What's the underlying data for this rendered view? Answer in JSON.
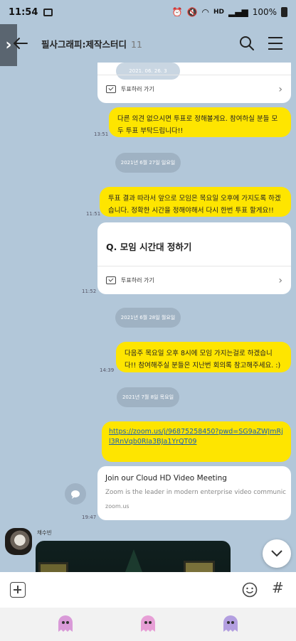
{
  "status_bar": {
    "time": "11:54",
    "network": "HD",
    "battery": "100%"
  },
  "header": {
    "title": "필사그래피:제작스터디",
    "member_count": "11"
  },
  "messages": {
    "card1": {
      "date_overlay": "2021. 06. 26. 3",
      "footer": "투표하러 가기"
    },
    "msg1": {
      "text": "다른 의견 없으시면 투표로 정해볼게요. 참여하실 분들 모두 투표 부탁드립니다!!",
      "time": "13:51"
    },
    "date1": "2021년 6월 27일 일요일",
    "msg2": {
      "text": "투표 결과 따라서 앞으로 모임은 목요일 오후에 가지도록 하겠습니다. 정확한 시간을 정해야해서 다시 한번 투표 할게요!!",
      "time": "11:51"
    },
    "card2": {
      "title": "Q. 모임 시간대 정하기",
      "footer": "투표하러 가기",
      "time": "11:52"
    },
    "date2": "2021년 6월 28일 월요일",
    "msg3": {
      "text": "다음주 목요일 오후 8시에 모임 가지는걸로 하겠습니다!! 참여해주실 분들은 지난번 회의록 참고해주세요. :)",
      "time": "14:39"
    },
    "date3": "2021년 7월 8일 목요일",
    "msg4": {
      "link": "https://zoom.us/j/96875258450?pwd=SG9aZWJmRjl3RnVqb0RIa3BJa1YrQT09"
    },
    "preview": {
      "title": "Join our Cloud HD Video Meeting",
      "desc": "Zoom is the leader in modern enterprise video communic...",
      "domain": "zoom.us",
      "time": "19:47"
    },
    "sender": {
      "name": "채수빈"
    }
  },
  "colors": {
    "background": "#b2c7d9",
    "my_bubble": "#fee500",
    "link": "#1a5fb4"
  }
}
